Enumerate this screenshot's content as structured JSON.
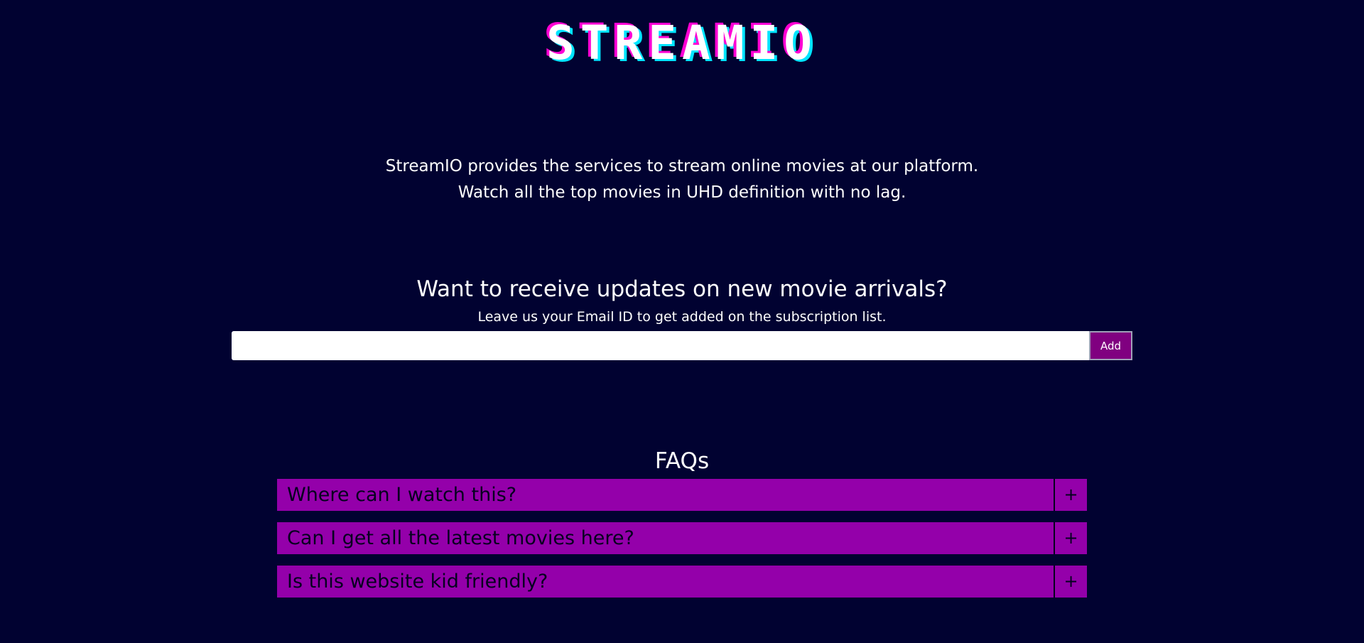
{
  "header": {
    "logo_text": "STREAMIO"
  },
  "intro": {
    "line1": "StreamIO provides the services to stream online movies at our platform.",
    "line2": "Watch all the top movies in UHD definition with no lag."
  },
  "subscribe": {
    "title": "Want to receive updates on new movie arrivals?",
    "subtitle": "Leave us your Email ID to get added on the subscription list.",
    "email_value": "",
    "email_placeholder": "",
    "add_label": "Add"
  },
  "faq": {
    "title": "FAQs",
    "items": [
      {
        "question": "Where can I watch this?",
        "toggle": "+"
      },
      {
        "question": "Can I get all the latest movies here?",
        "toggle": "+"
      },
      {
        "question": "Is this website kid friendly?",
        "toggle": "+"
      }
    ]
  },
  "colors": {
    "background": "#010231",
    "accent": "#9400aa",
    "button": "#800080",
    "logo_shadow_pink": "#ff00d4",
    "logo_shadow_cyan": "#00e5ff"
  }
}
